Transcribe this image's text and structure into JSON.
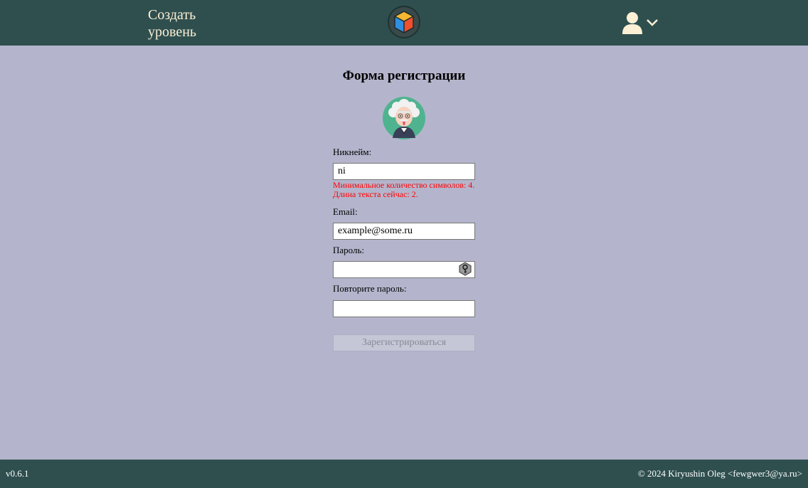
{
  "header": {
    "create_level": "Создать уровень",
    "logo_icon": "cube-logo-icon",
    "user_icon": "user-icon",
    "chevron_icon": "chevron-down-icon",
    "background_color": "#2f4f4f"
  },
  "form": {
    "title": "Форма регистрации",
    "avatar_icon": "einstein-avatar-icon",
    "nickname": {
      "label": "Никнейм:",
      "value": "ni",
      "error": "Минимальное количество символов: 4. Длина текста сейчас: 2."
    },
    "email": {
      "label": "Email:",
      "value": "example@some.ru"
    },
    "password": {
      "label": "Пароль:",
      "value": "",
      "toggle_icon": "key-icon"
    },
    "repeat_password": {
      "label": "Повторите пароль:",
      "value": ""
    },
    "submit_label": "Зарегистрироваться",
    "submit_disabled": true,
    "error_color": "#ff0000"
  },
  "footer": {
    "version": "v0.6.1",
    "copyright": "© 2024 Kiryushin Oleg <fewgwer3@ya.ru>"
  }
}
